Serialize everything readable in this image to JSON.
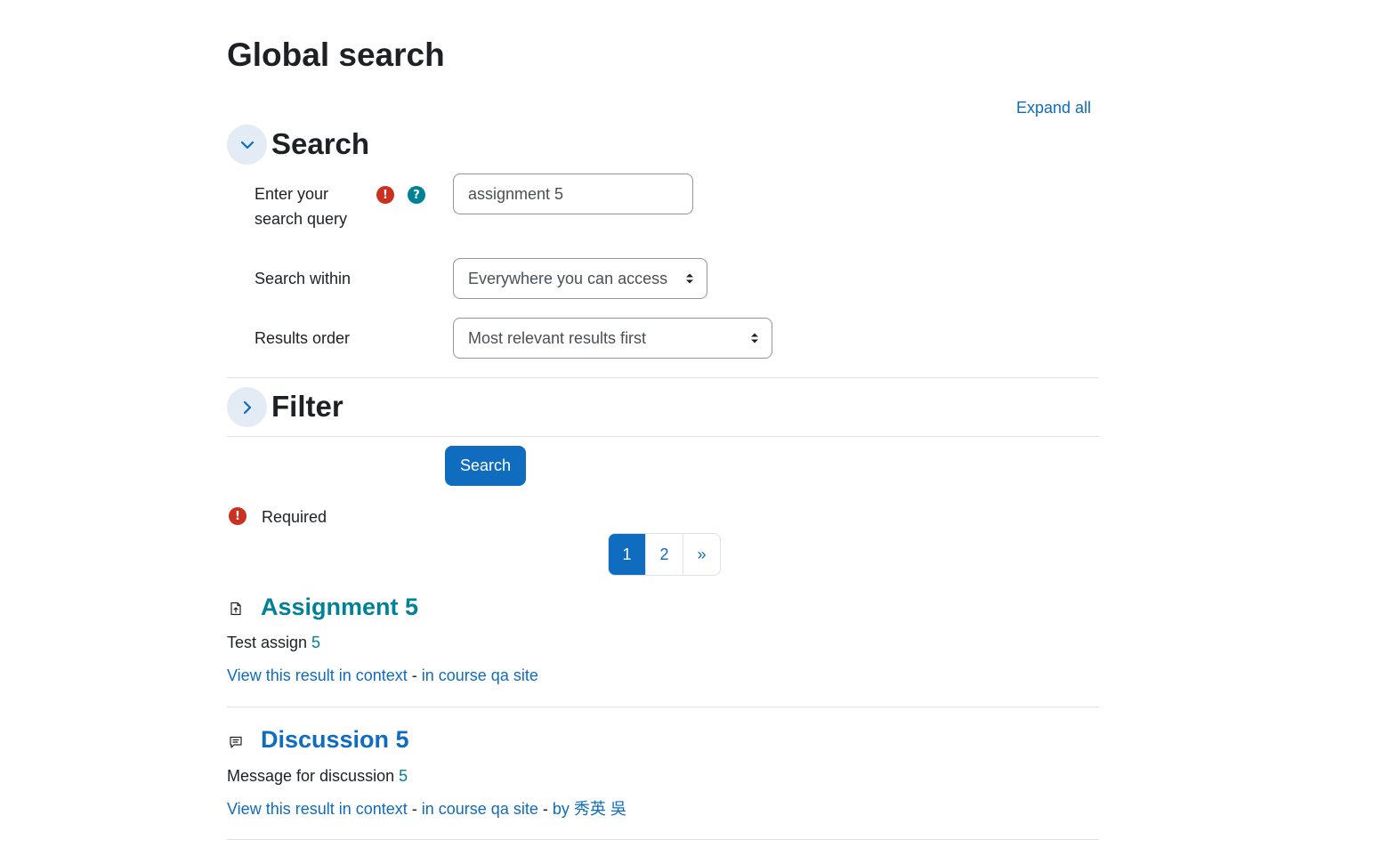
{
  "page": {
    "title": "Global search",
    "expand_all": "Expand all"
  },
  "search_section": {
    "heading": "Search",
    "query_label": "Enter your search query",
    "query_value": "assignment 5",
    "within_label": "Search within",
    "within_value": "Everywhere you can access",
    "order_label": "Results order",
    "order_value": "Most relevant results first"
  },
  "filter_section": {
    "heading": "Filter"
  },
  "actions": {
    "search_button": "Search",
    "required_label": "Required"
  },
  "pagination": {
    "pages": [
      "1",
      "2"
    ],
    "next": "»",
    "active": "1"
  },
  "results": [
    {
      "icon": "assignment-icon",
      "title": "Assignment 5",
      "text": "Test assign ",
      "highlight": "5",
      "context_link": "View this result in context",
      "separator": " - ",
      "course_link": "in course qa site"
    },
    {
      "icon": "forum-icon",
      "title": "Discussion 5",
      "text": "Message for discussion ",
      "highlight": "5",
      "context_link": "View this result in context",
      "separator": " - ",
      "course_link": "in course qa site",
      "author_separator": " - ",
      "author_link": "by 秀英 吳"
    }
  ],
  "colors": {
    "primary": "#0f6cbf",
    "teal": "#008196",
    "danger": "#ca3120"
  }
}
